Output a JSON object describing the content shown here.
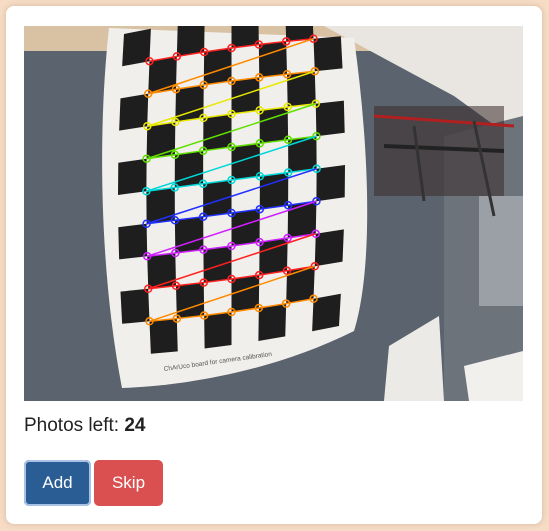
{
  "status": {
    "label": "Photos left:",
    "count": "24"
  },
  "buttons": {
    "add_label": "Add",
    "skip_label": "Skip"
  },
  "photo": {
    "board_caption": "ChArUco board for camera calibration",
    "row_colors": [
      "#ff2020",
      "#ff8a00",
      "#e8e800",
      "#60e000",
      "#00d8d8",
      "#2030ff",
      "#d020ff",
      "#ff2020",
      "#ff8a00"
    ]
  }
}
